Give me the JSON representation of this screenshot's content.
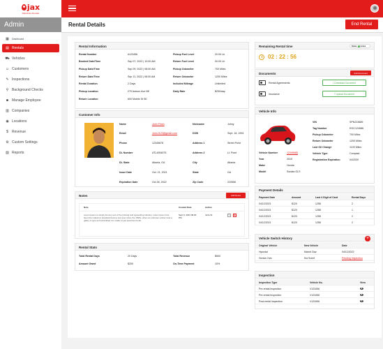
{
  "brand": {
    "logo_text": "jax",
    "logo_sub": "Rideshare Rentals"
  },
  "sidebar": {
    "title": "Admin",
    "items": [
      {
        "label": "Dashboard",
        "icon": "dashboard-icon"
      },
      {
        "label": "Rentals",
        "icon": "rentals-icon",
        "active": true
      },
      {
        "label": "Vehicles",
        "icon": "vehicle-icon"
      },
      {
        "label": "Customers",
        "icon": "customers-icon"
      },
      {
        "label": "Inspections",
        "icon": "inspections-icon"
      },
      {
        "label": "Background Checks",
        "icon": "background-check-icon"
      },
      {
        "label": "Manage Employee",
        "icon": "employee-icon"
      },
      {
        "label": "Companies",
        "icon": "companies-icon"
      },
      {
        "label": "Locations",
        "icon": "locations-icon"
      },
      {
        "label": "Revenue",
        "icon": "revenue-icon"
      },
      {
        "label": "Custom Settings",
        "icon": "settings-icon"
      },
      {
        "label": "Reports",
        "icon": "reports-icon"
      }
    ]
  },
  "header": {
    "title": "Rental Details",
    "end_button": "End Rental"
  },
  "rental_info": {
    "title": "Rental Information",
    "left": [
      {
        "k": "Rental Number",
        "v": "#123456"
      },
      {
        "k": "Booked Date/Time",
        "v": "Sep 07, 2022 | 10:00 AM"
      },
      {
        "k": "Pickup Date/Time",
        "v": "Sep 09, 2022 | 08:00 AM"
      },
      {
        "k": "Return Date/Time",
        "v": "Sep 11, 2022 | 08:00 AM"
      },
      {
        "k": "Rental Duration",
        "v": "2 Days"
      },
      {
        "k": "Pickup Location",
        "v": "270 Auburn Ave NE"
      },
      {
        "k": "Return Location",
        "v": "600 Mobile St SE"
      }
    ],
    "right": [
      {
        "k": "Pickup Fuel Level",
        "v": "20.00 Ltr"
      },
      {
        "k": "Return Fuel Level",
        "v": "00.00 Ltr"
      },
      {
        "k": "Pickup Odometer",
        "v": "700 Miles"
      },
      {
        "k": "Return Odometer",
        "v": "1200 Miles"
      },
      {
        "k": "Included Mileage",
        "v": "Unlimited"
      },
      {
        "k": "Daily Rate",
        "v": "$250/day"
      }
    ]
  },
  "remaining": {
    "title": "Remaining Rental time",
    "toggle_label": "Status",
    "toggle_value": "Active",
    "time": "02 : 22 : 56"
  },
  "documents": {
    "title": "Documents",
    "add_button": "Add Document",
    "items": [
      {
        "name": "Rental Agreements",
        "action": "Download Document"
      },
      {
        "name": "Insurance",
        "action": "Upload Document"
      }
    ]
  },
  "customer": {
    "title": "Customer Info",
    "left": [
      {
        "k": "Name",
        "v": "John Finch",
        "link": true
      },
      {
        "k": "Email",
        "v": "John.f123@gmail.com",
        "link": true
      },
      {
        "k": "Phone",
        "v": "12345678"
      },
      {
        "k": "DL Number",
        "v": "ATL4954575"
      },
      {
        "k": "DL State",
        "v": "Atlanta, GA"
      },
      {
        "k": "Issue Date",
        "v": "Oct. 21, 2021"
      },
      {
        "k": "Expiration Date",
        "v": "Oct 26, 2022"
      }
    ],
    "right": [
      {
        "k": "Nickname",
        "v": "Johny"
      },
      {
        "k": "DOB",
        "v": "Sept. 18, 1994"
      },
      {
        "k": "Address 1",
        "v": "Street Point"
      },
      {
        "k": "Address 2",
        "v": "Lt. Point"
      },
      {
        "k": "City",
        "v": "Atlanta"
      },
      {
        "k": "State",
        "v": "GA"
      },
      {
        "k": "Zip Code",
        "v": "220556"
      }
    ]
  },
  "notes": {
    "title": "Notes",
    "add_button": "Add Notes",
    "headers": [
      "Note",
      "Created Date",
      "Author"
    ],
    "rows": [
      {
        "note": "Lorem Ipsum is simply dummy text of the printing and typesetting industry. Lorem Ipsum has been the industry's standard dummy text ever since the 1500s, when an unknown printer took a galley of type and scrambled it to make a type specimen book.",
        "date": "Sept 9, 2021 09:00 PM",
        "author": "Judo W."
      }
    ]
  },
  "stats": {
    "title": "Rental Stats",
    "items": [
      {
        "k": "Total Rental Days",
        "v": "20 Days"
      },
      {
        "k": "Total Revenue",
        "v": "$500"
      },
      {
        "k": "Amount Owed",
        "v": "$200"
      },
      {
        "k": "On-Time Payment",
        "v": "10%"
      }
    ]
  },
  "vehicle": {
    "title": "Vehicle Info",
    "left": [
      {
        "k": "Vehicle Number",
        "v": "12345685",
        "link": true
      },
      {
        "k": "Year",
        "v": "2019"
      },
      {
        "k": "Make",
        "v": "Honda"
      },
      {
        "k": "Model",
        "v": "Sonata GLS"
      }
    ],
    "right": [
      {
        "k": "VIN",
        "v": "SPN223689"
      },
      {
        "k": "Tag Number",
        "v": "RGC124586"
      },
      {
        "k": "Pickup Odometer",
        "v": "700 Miles"
      },
      {
        "k": "Return Odometer",
        "v": "1200 Miles"
      },
      {
        "k": "Last Oil Change",
        "v": "1100 Miles"
      },
      {
        "k": "Vehicle Type",
        "v": "Compact"
      },
      {
        "k": "Registration Expiration",
        "v": "04/2030"
      }
    ]
  },
  "payment": {
    "title": "Payment Details",
    "headers": [
      "Payment Date",
      "Amount",
      "Last 4 Digit of Card",
      "Rental Days"
    ],
    "rows": [
      [
        "04/12/2021",
        "$120",
        "1258",
        "2"
      ],
      [
        "04/12/2021",
        "$120",
        "1258",
        "1"
      ],
      [
        "04/12/2021",
        "$120",
        "1258",
        "2"
      ],
      [
        "04/12/2021",
        "$120",
        "1258",
        "2"
      ]
    ]
  },
  "switch": {
    "title": "Vehicle Switch History",
    "headers": [
      "Original Vehicle",
      "New Vehicle",
      "Date"
    ],
    "rows": [
      {
        "orig": "Hyundai",
        "new": "Maruti Ciaz",
        "date": "04/12/2022",
        "link": false
      },
      {
        "orig": "Honda Civic",
        "new": "Kia Sonet",
        "date": "Pending Inspection",
        "link": true
      }
    ]
  },
  "inspection": {
    "title": "Inspection",
    "headers": [
      "Inspection Type",
      "Vehicle No.",
      "View"
    ],
    "rows": [
      [
        "Pre-rental Inspection",
        "V123456"
      ],
      [
        "Pre-rental Inspection",
        "V123456"
      ],
      [
        "Post-rental Inspection",
        "V123456"
      ]
    ]
  }
}
